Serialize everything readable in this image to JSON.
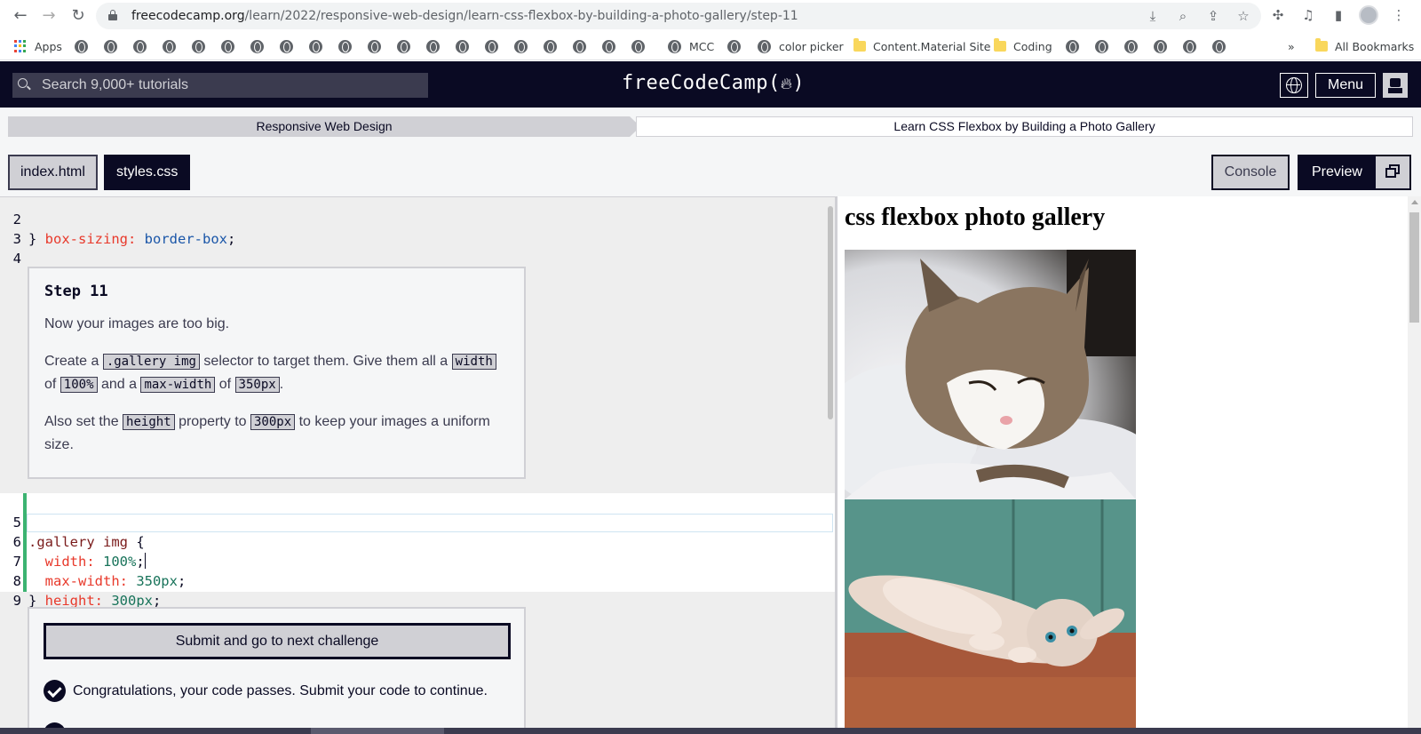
{
  "browser": {
    "url_host": "freecodecamp.org",
    "url_path": "/learn/2022/responsive-web-design/learn-css-flexbox-by-building-a-photo-gallery/step-11",
    "bookmarks": {
      "apps": "Apps",
      "mcc": "MCC",
      "color_picker": "color picker",
      "content_material": "Content.Material Site",
      "coding": "Coding",
      "overflow": "»",
      "all_bookmarks": "All Bookmarks"
    }
  },
  "header": {
    "search_placeholder": "Search 9,000+ tutorials",
    "logo": "freeCodeCamp(",
    "logo_end": ")",
    "menu_label": "Menu"
  },
  "breadcrumbs": {
    "superblock": "Responsive Web Design",
    "block": "Learn CSS Flexbox by Building a Photo Gallery"
  },
  "editor_tabs": [
    "index.html",
    "styles.css"
  ],
  "preview_controls": {
    "console": "Console",
    "preview": "Preview"
  },
  "code_top": [
    {
      "ln": "2",
      "prop": "  box-sizing:",
      "val": " border-box",
      "end": ";"
    },
    {
      "ln": "3",
      "text": "}"
    },
    {
      "ln": "4",
      "text": ""
    }
  ],
  "instructions": {
    "title": "Step 11",
    "p1": "Now your images are too big.",
    "p2_a": "Create a ",
    "p2_code1": ".gallery img",
    "p2_b": " selector to target them. Give them all a ",
    "p2_code2": "width",
    "p2_c": " of ",
    "p2_code3": "100%",
    "p2_d": " and a ",
    "p2_code4": "max-width",
    "p2_e": " of ",
    "p2_code5": "350px",
    "p2_f": ".",
    "p3_a": "Also set the ",
    "p3_code1": "height",
    "p3_b": " property to ",
    "p3_code2": "300px",
    "p3_c": " to keep your images a uniform size."
  },
  "code_block": {
    "l5": {
      "ln": "5",
      "sel": ".gallery img",
      "brace": " {"
    },
    "l6": {
      "ln": "6",
      "prop": "  width:",
      "val": " 100%",
      "end": ";"
    },
    "l7": {
      "ln": "7",
      "prop": "  max-width:",
      "val": " 350px",
      "end": ";"
    },
    "l8": {
      "ln": "8",
      "prop": "  height:",
      "val": " 300px",
      "end": ";"
    },
    "l9": {
      "ln": "9",
      "text": "}"
    }
  },
  "submit": {
    "button": "Submit and go to next challenge",
    "pass_message": "Congratulations, your code passes. Submit your code to continue."
  },
  "preview": {
    "heading": "css flexbox photo gallery"
  }
}
